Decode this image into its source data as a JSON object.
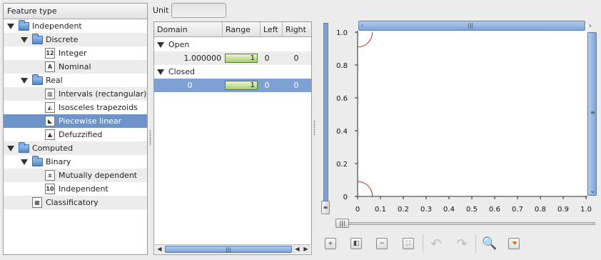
{
  "tree": {
    "header": "Feature type",
    "rows": [
      {
        "label": "Independent",
        "kind": "folder",
        "level": 0,
        "expanded": true
      },
      {
        "label": "Discrete",
        "kind": "folder",
        "level": 1,
        "expanded": true
      },
      {
        "label": "Integer",
        "kind": "file",
        "level": 2,
        "icon": "integer-icon"
      },
      {
        "label": "Nominal",
        "kind": "file",
        "level": 2,
        "icon": "nominal-icon"
      },
      {
        "label": "Real",
        "kind": "folder",
        "level": 1,
        "expanded": true
      },
      {
        "label": "Intervals (rectangular)",
        "kind": "file",
        "level": 2,
        "icon": "intervals-icon"
      },
      {
        "label": "Isosceles trapezoids",
        "kind": "file",
        "level": 2,
        "icon": "trapezoid-icon"
      },
      {
        "label": "Piecewise linear",
        "kind": "file",
        "level": 2,
        "icon": "piecewise-icon",
        "selected": true
      },
      {
        "label": "Defuzzified",
        "kind": "file",
        "level": 2,
        "icon": "defuzzified-icon"
      },
      {
        "label": "Computed",
        "kind": "folder",
        "level": 0,
        "expanded": true
      },
      {
        "label": "Binary",
        "kind": "folder",
        "level": 1,
        "expanded": true
      },
      {
        "label": "Mutually dependent",
        "kind": "file",
        "level": 2,
        "icon": "mutually-dependent-icon"
      },
      {
        "label": "Independent",
        "kind": "file",
        "level": 2,
        "icon": "binary-independent-icon"
      },
      {
        "label": "Classificatory",
        "kind": "file",
        "level": 1,
        "icon": "classificatory-icon"
      }
    ]
  },
  "unit": {
    "label": "Unit",
    "value": ""
  },
  "table": {
    "columns": [
      "Domain",
      "Range",
      "Left",
      "Right"
    ],
    "groups": [
      {
        "label": "Open",
        "row": {
          "domain": "1.000000",
          "range": "1",
          "left": "0",
          "right": "0",
          "selected": false
        }
      },
      {
        "label": "Closed",
        "row": {
          "domain": "0",
          "range": "1",
          "left": "0",
          "right": "0",
          "selected": true
        }
      }
    ]
  },
  "chart_data": {
    "type": "line",
    "x_ticks": [
      "0",
      "0.1",
      "0.2",
      "0.3",
      "0.4",
      "0.5",
      "0.6",
      "0.7",
      "0.8",
      "0.9",
      "1.0"
    ],
    "y_ticks": [
      "0",
      "0.2",
      "0.4",
      "0.6",
      "0.8",
      "1.0"
    ],
    "xlim": [
      0,
      1
    ],
    "ylim": [
      0,
      1
    ],
    "curve_color": "#cc2222"
  },
  "toolbar": {
    "items": [
      "add-point-icon",
      "copy-icon",
      "remove-icon",
      "fit-view-icon",
      "undo-icon",
      "redo-icon",
      "zoom-icon",
      "pan-icon"
    ]
  },
  "colors": {
    "selection": "#6e93c8",
    "range_bar": "#a9cd72",
    "scroll": "#7da3d9"
  }
}
